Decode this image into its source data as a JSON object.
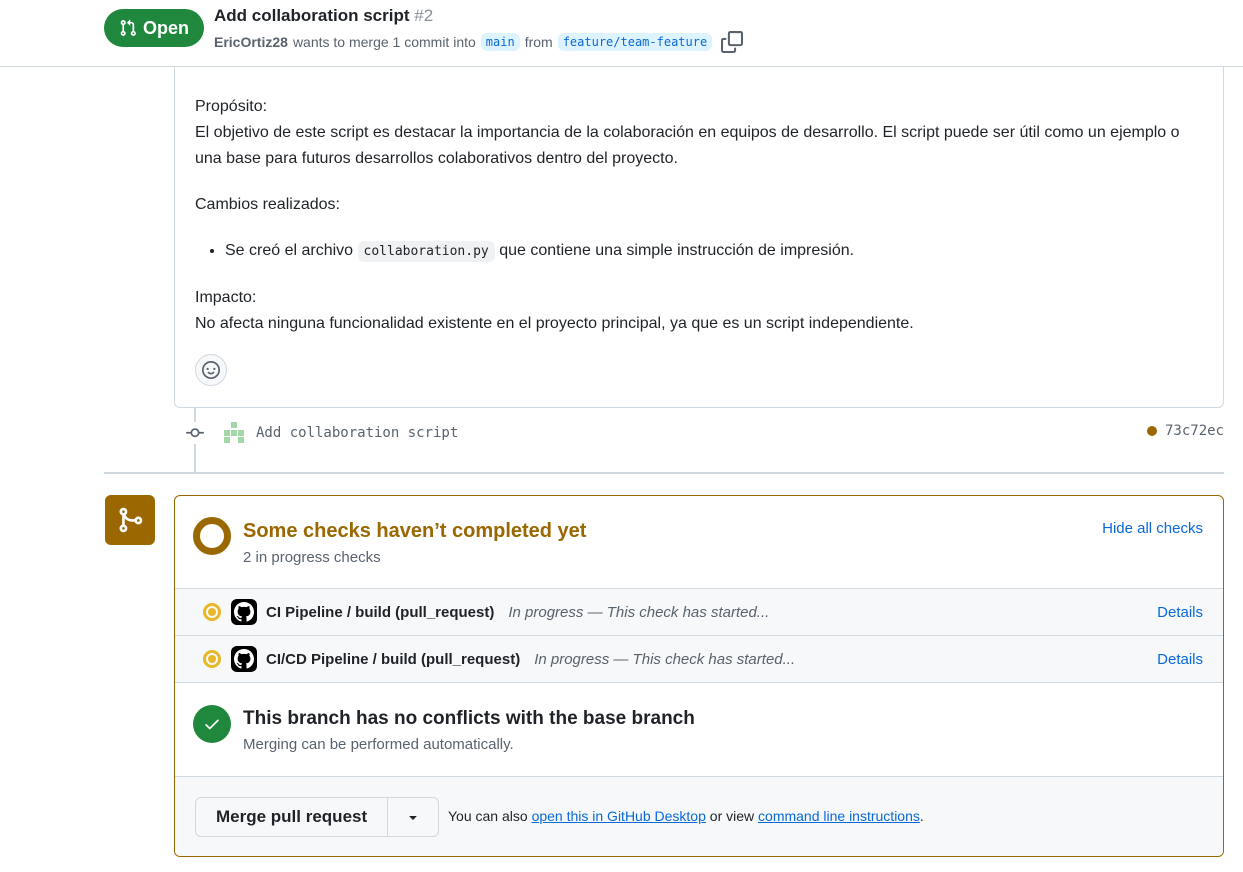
{
  "header": {
    "state": "Open",
    "title": "Add collaboration script",
    "number": "#2",
    "author": "EricOrtiz28",
    "merge_text": "wants to merge 1 commit into",
    "base_branch": "main",
    "from_text": "from",
    "head_branch": "feature/team-feature"
  },
  "description": {
    "purpose_label": "Propósito:",
    "purpose_text": "El objetivo de este script es destacar la importancia de la colaboración en equipos de desarrollo. El script puede ser útil como un ejemplo o una base para futuros desarrollos colaborativos dentro del proyecto.",
    "changes_label": "Cambios realizados:",
    "change_prefix": "Se creó el archivo",
    "change_file": "collaboration.py",
    "change_suffix": "que contiene una simple instrucción de impresión.",
    "impact_label": "Impacto:",
    "impact_text": "No afecta ninguna funcionalidad existente en el proyecto principal, ya que es un script independiente."
  },
  "commit": {
    "message": "Add collaboration script",
    "sha": "73c72ec"
  },
  "checks": {
    "title": "Some checks haven’t completed yet",
    "subtitle": "2 in progress checks",
    "hide_label": "Hide all checks",
    "items": [
      {
        "name": "CI Pipeline / build (pull_request)",
        "status": "In progress — This check has started...",
        "details": "Details"
      },
      {
        "name": "CI/CD Pipeline / build (pull_request)",
        "status": "In progress — This check has started...",
        "details": "Details"
      }
    ]
  },
  "conflicts": {
    "title": "This branch has no conflicts with the base branch",
    "subtitle": "Merging can be performed automatically."
  },
  "merge": {
    "button_label": "Merge pull request",
    "alt_prefix": "You can also",
    "desktop_link": "open this in GitHub Desktop",
    "alt_middle": "or view",
    "cli_link": "command line instructions",
    "alt_suffix": "."
  },
  "colors": {
    "open_green": "#1f883d",
    "pending_amber": "#9a6700",
    "link_blue": "#0969da",
    "in_progress_yellow": "#e8b829"
  },
  "icons": [
    "git-pull-request-icon",
    "copy-icon",
    "smiley-icon",
    "git-commit-icon",
    "git-merge-icon",
    "github-icon",
    "check-icon",
    "triangle-down-icon"
  ]
}
